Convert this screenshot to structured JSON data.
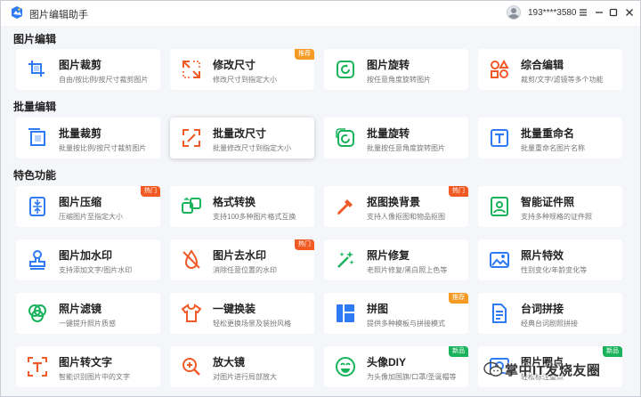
{
  "app": {
    "title": "图片编辑助手"
  },
  "user": {
    "id": "193****3580"
  },
  "icon_color": "#2f7bf5",
  "sections": [
    {
      "title": "图片编辑"
    },
    {
      "title": "批量编辑"
    },
    {
      "title": "特色功能"
    }
  ],
  "cards": [
    {
      "title": "图片裁剪",
      "desc": "自由/按比例/按尺寸裁剪图片",
      "icon": "crop-icon",
      "icon_color": "#2f7bf5"
    },
    {
      "title": "修改尺寸",
      "desc": "修改尺寸到指定大小",
      "icon": "resize-icon",
      "icon_color": "#f05a28",
      "badge": "推荐",
      "badge_type": "rec"
    },
    {
      "title": "图片旋转",
      "desc": "按任意角度旋转图片",
      "icon": "rotate-icon",
      "icon_color": "#19b35c"
    },
    {
      "title": "综合编辑",
      "desc": "裁剪/文字/滤镜等多个功能",
      "icon": "shapes-icon",
      "icon_color": "#f05a28"
    },
    {
      "title": "批量裁剪",
      "desc": "批量按比例/按尺寸裁剪图片",
      "icon": "batch-crop-icon",
      "icon_color": "#2f7bf5"
    },
    {
      "title": "批量改尺寸",
      "desc": "批量修改尺寸到指定大小",
      "icon": "batch-resize-icon",
      "icon_color": "#f05a28",
      "active": true
    },
    {
      "title": "批量旋转",
      "desc": "批量按任意角度旋转图片",
      "icon": "batch-rotate-icon",
      "icon_color": "#19b35c"
    },
    {
      "title": "批量重命名",
      "desc": "批量重命名图片名称",
      "icon": "rename-icon",
      "icon_color": "#2f7bf5"
    },
    {
      "title": "图片压缩",
      "desc": "压缩图片至指定大小",
      "icon": "compress-icon",
      "icon_color": "#2f7bf5",
      "badge": "热门",
      "badge_type": "hot"
    },
    {
      "title": "格式转换",
      "desc": "支持100多种图片格式互换",
      "icon": "convert-icon",
      "icon_color": "#19b35c"
    },
    {
      "title": "抠图换背景",
      "desc": "支持人像抠图和物品抠图",
      "icon": "cutout-icon",
      "icon_color": "#f05a28",
      "badge": "热门",
      "badge_type": "hot"
    },
    {
      "title": "智能证件照",
      "desc": "支持多种规格的证件照",
      "icon": "id-photo-icon",
      "icon_color": "#19b35c"
    },
    {
      "title": "图片加水印",
      "desc": "支持添加文字/图片水印",
      "icon": "stamp-icon",
      "icon_color": "#2f7bf5"
    },
    {
      "title": "图片去水印",
      "desc": "消除任意位置的水印",
      "icon": "drop-off-icon",
      "icon_color": "#f05a28",
      "badge": "热门",
      "badge_type": "hot"
    },
    {
      "title": "照片修复",
      "desc": "老照片修复/黑白照上色等",
      "icon": "magic-wand-icon",
      "icon_color": "#19b35c"
    },
    {
      "title": "照片特效",
      "desc": "性别变化/年龄变化等",
      "icon": "picture-icon",
      "icon_color": "#2f7bf5"
    },
    {
      "title": "照片滤镜",
      "desc": "一键提升照片质感",
      "icon": "filter-icon",
      "icon_color": "#19b35c"
    },
    {
      "title": "一键换装",
      "desc": "轻松更换场景及装扮风格",
      "icon": "shirt-icon",
      "icon_color": "#f05a28"
    },
    {
      "title": "拼图",
      "desc": "提供多种模板与拼接模式",
      "icon": "collage-icon",
      "icon_color": "#2f7bf5",
      "badge": "推荐",
      "badge_type": "rec"
    },
    {
      "title": "台词拼接",
      "desc": "经典台词剧照拼接",
      "icon": "quote-stitch-icon",
      "icon_color": "#2f7bf5"
    },
    {
      "title": "图片转文字",
      "desc": "智能识别图片中的文字",
      "icon": "ocr-icon",
      "icon_color": "#f05a28"
    },
    {
      "title": "放大镜",
      "desc": "对图片进行局部放大",
      "icon": "magnifier-icon",
      "icon_color": "#f05a28"
    },
    {
      "title": "头像DIY",
      "desc": "为头像加国旗/口罩/圣诞帽等",
      "icon": "smiley-icon",
      "icon_color": "#19b35c",
      "badge": "新品",
      "badge_type": "new"
    },
    {
      "title": "图片圈点",
      "desc": "轻松标注重点",
      "icon": "annotate-icon",
      "icon_color": "#2f7bf5",
      "badge": "新品",
      "badge_type": "new"
    }
  ],
  "watermark": {
    "text": "掌中IT发烧友圈"
  }
}
